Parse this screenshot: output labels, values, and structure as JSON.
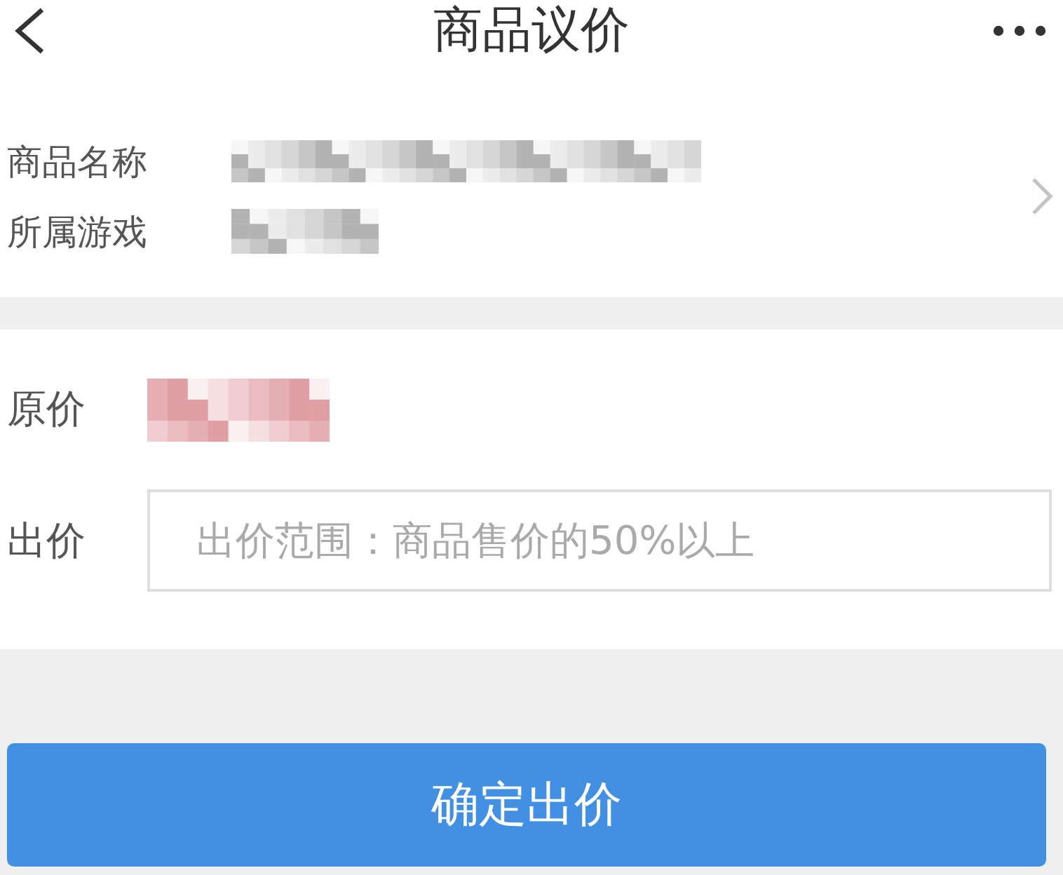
{
  "header": {
    "title": "商品议价"
  },
  "product": {
    "fields": [
      {
        "label": "商品名称",
        "redacted": true
      },
      {
        "label": "所属游戏",
        "redacted": true
      }
    ]
  },
  "price": {
    "original": {
      "label": "原价",
      "redacted": true
    },
    "bid": {
      "label": "出价",
      "placeholder": "出价范围：商品售价的50%以上"
    }
  },
  "submit_button": {
    "label": "确定出价"
  }
}
